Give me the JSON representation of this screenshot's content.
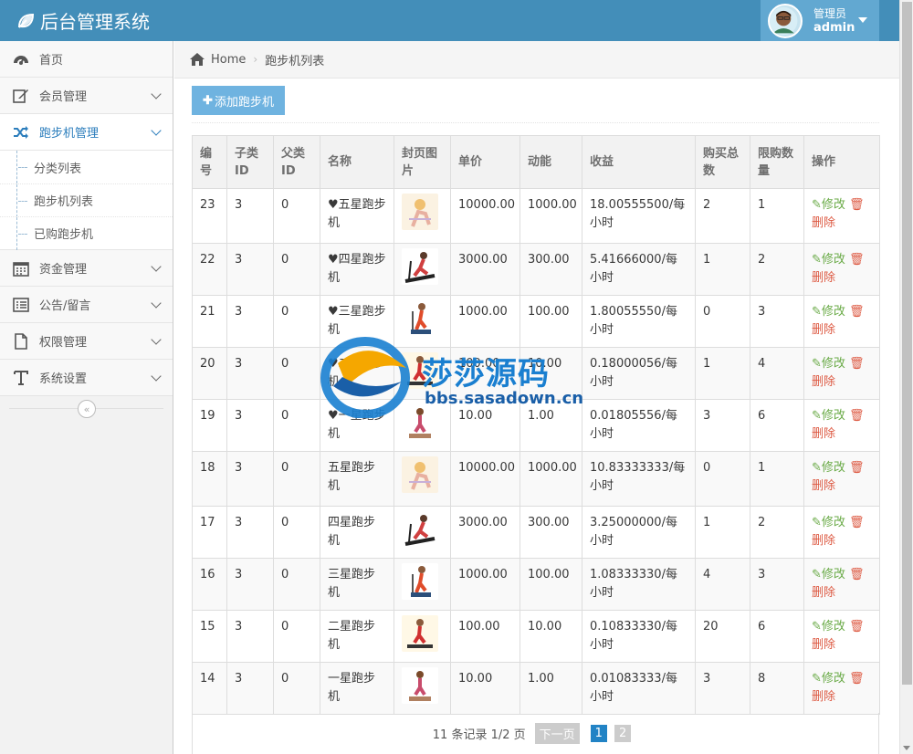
{
  "header": {
    "title": "后台管理系统",
    "user_role": "管理员",
    "user_name": "admin"
  },
  "sidebar": {
    "items": [
      {
        "label": "首页",
        "icon": "dashboard-icon"
      },
      {
        "label": "会员管理",
        "icon": "edit-icon"
      },
      {
        "label": "跑步机管理",
        "icon": "shuffle-icon",
        "active": true
      },
      {
        "label": "资金管理",
        "icon": "calendar-icon"
      },
      {
        "label": "公告/留言",
        "icon": "list-alt-icon"
      },
      {
        "label": "权限管理",
        "icon": "file-icon"
      },
      {
        "label": "系统设置",
        "icon": "text-icon"
      }
    ],
    "submenu": [
      "分类列表",
      "跑步机列表",
      "已购跑步机"
    ]
  },
  "breadcrumb": {
    "home": "Home",
    "current": "跑步机列表"
  },
  "toolbar": {
    "add_label": "添加跑步机"
  },
  "table": {
    "headers": [
      "编号",
      "子类ID",
      "父类ID",
      "名称",
      "封页图片",
      "单价",
      "动能",
      "收益",
      "购买总数",
      "限购数量",
      "操作"
    ],
    "edit_label": "修改",
    "delete_label": "删除",
    "rows": [
      {
        "id": "23",
        "sub": "3",
        "parent": "0",
        "name": "♥五星跑步机",
        "img": "cartoon-woman-running",
        "price": "10000.00",
        "energy": "1000.00",
        "income": "18.00555500/每小时",
        "bought": "2",
        "limit": "1"
      },
      {
        "id": "22",
        "sub": "3",
        "parent": "0",
        "name": "♥四星跑步机",
        "img": "woman-on-treadmill",
        "price": "3000.00",
        "energy": "300.00",
        "income": "5.41666000/每小时",
        "bought": "1",
        "limit": "2"
      },
      {
        "id": "21",
        "sub": "3",
        "parent": "0",
        "name": "♥三星跑步机",
        "img": "man-on-treadmill",
        "price": "1000.00",
        "energy": "100.00",
        "income": "1.80055550/每小时",
        "bought": "0",
        "limit": "3"
      },
      {
        "id": "20",
        "sub": "3",
        "parent": "0",
        "name": "♥二星跑步机",
        "img": "man-running-treadmill",
        "price": "100.00",
        "energy": "10.00",
        "income": "0.18000056/每小时",
        "bought": "1",
        "limit": "4"
      },
      {
        "id": "19",
        "sub": "3",
        "parent": "0",
        "name": "♥一星跑步机",
        "img": "woman-stepper",
        "price": "10.00",
        "energy": "1.00",
        "income": "0.01805556/每小时",
        "bought": "3",
        "limit": "6"
      },
      {
        "id": "18",
        "sub": "3",
        "parent": "0",
        "name": "五星跑步机",
        "img": "cartoon-woman-running",
        "price": "10000.00",
        "energy": "1000.00",
        "income": "10.83333333/每小时",
        "bought": "0",
        "limit": "1"
      },
      {
        "id": "17",
        "sub": "3",
        "parent": "0",
        "name": "四星跑步机",
        "img": "woman-on-treadmill",
        "price": "3000.00",
        "energy": "300.00",
        "income": "3.25000000/每小时",
        "bought": "1",
        "limit": "2"
      },
      {
        "id": "16",
        "sub": "3",
        "parent": "0",
        "name": "三星跑步机",
        "img": "man-on-treadmill",
        "price": "1000.00",
        "energy": "100.00",
        "income": "1.08333330/每小时",
        "bought": "4",
        "limit": "3"
      },
      {
        "id": "15",
        "sub": "3",
        "parent": "0",
        "name": "二星跑步机",
        "img": "man-running-treadmill",
        "price": "100.00",
        "energy": "10.00",
        "income": "0.10833330/每小时",
        "bought": "20",
        "limit": "6"
      },
      {
        "id": "14",
        "sub": "3",
        "parent": "0",
        "name": "一星跑步机",
        "img": "woman-stepper",
        "price": "10.00",
        "energy": "1.00",
        "income": "0.01083333/每小时",
        "bought": "3",
        "limit": "8"
      }
    ]
  },
  "pagination": {
    "info": "11 条记录 1/2 页",
    "next": "下一页",
    "pages": [
      "1",
      "2"
    ],
    "current": "1"
  },
  "watermark": {
    "text": "莎莎源码",
    "url": "bbs.sasadown.cn"
  },
  "colors": {
    "navbar": "#438eb9",
    "accent": "#2b7dbc",
    "add_button": "#6fb3e0",
    "edit": "#69aa46",
    "delete": "#dd5a43"
  }
}
